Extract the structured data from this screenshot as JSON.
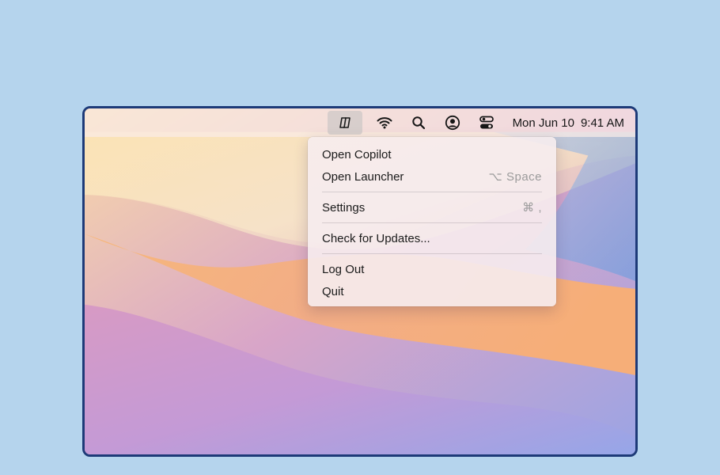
{
  "menubar": {
    "icons": [
      {
        "name": "copilot-icon",
        "active": true
      },
      {
        "name": "wifi-icon"
      },
      {
        "name": "search-icon"
      },
      {
        "name": "user-account-icon"
      },
      {
        "name": "control-center-icon"
      }
    ],
    "clock_date": "Mon Jun 10",
    "clock_time": "9:41 AM"
  },
  "dropdown": {
    "items": [
      {
        "label": "Open Copilot",
        "shortcut": ""
      },
      {
        "label": "Open Launcher",
        "shortcut": "⌥ Space"
      },
      {
        "label": "Settings",
        "shortcut": "⌘ ,"
      },
      {
        "label": "Check for Updates...",
        "shortcut": ""
      },
      {
        "label": "Log Out",
        "shortcut": ""
      },
      {
        "label": "Quit",
        "shortcut": ""
      }
    ]
  },
  "colors": {
    "page_background": "#b5d4ed",
    "frame_border": "#1d3a78"
  }
}
